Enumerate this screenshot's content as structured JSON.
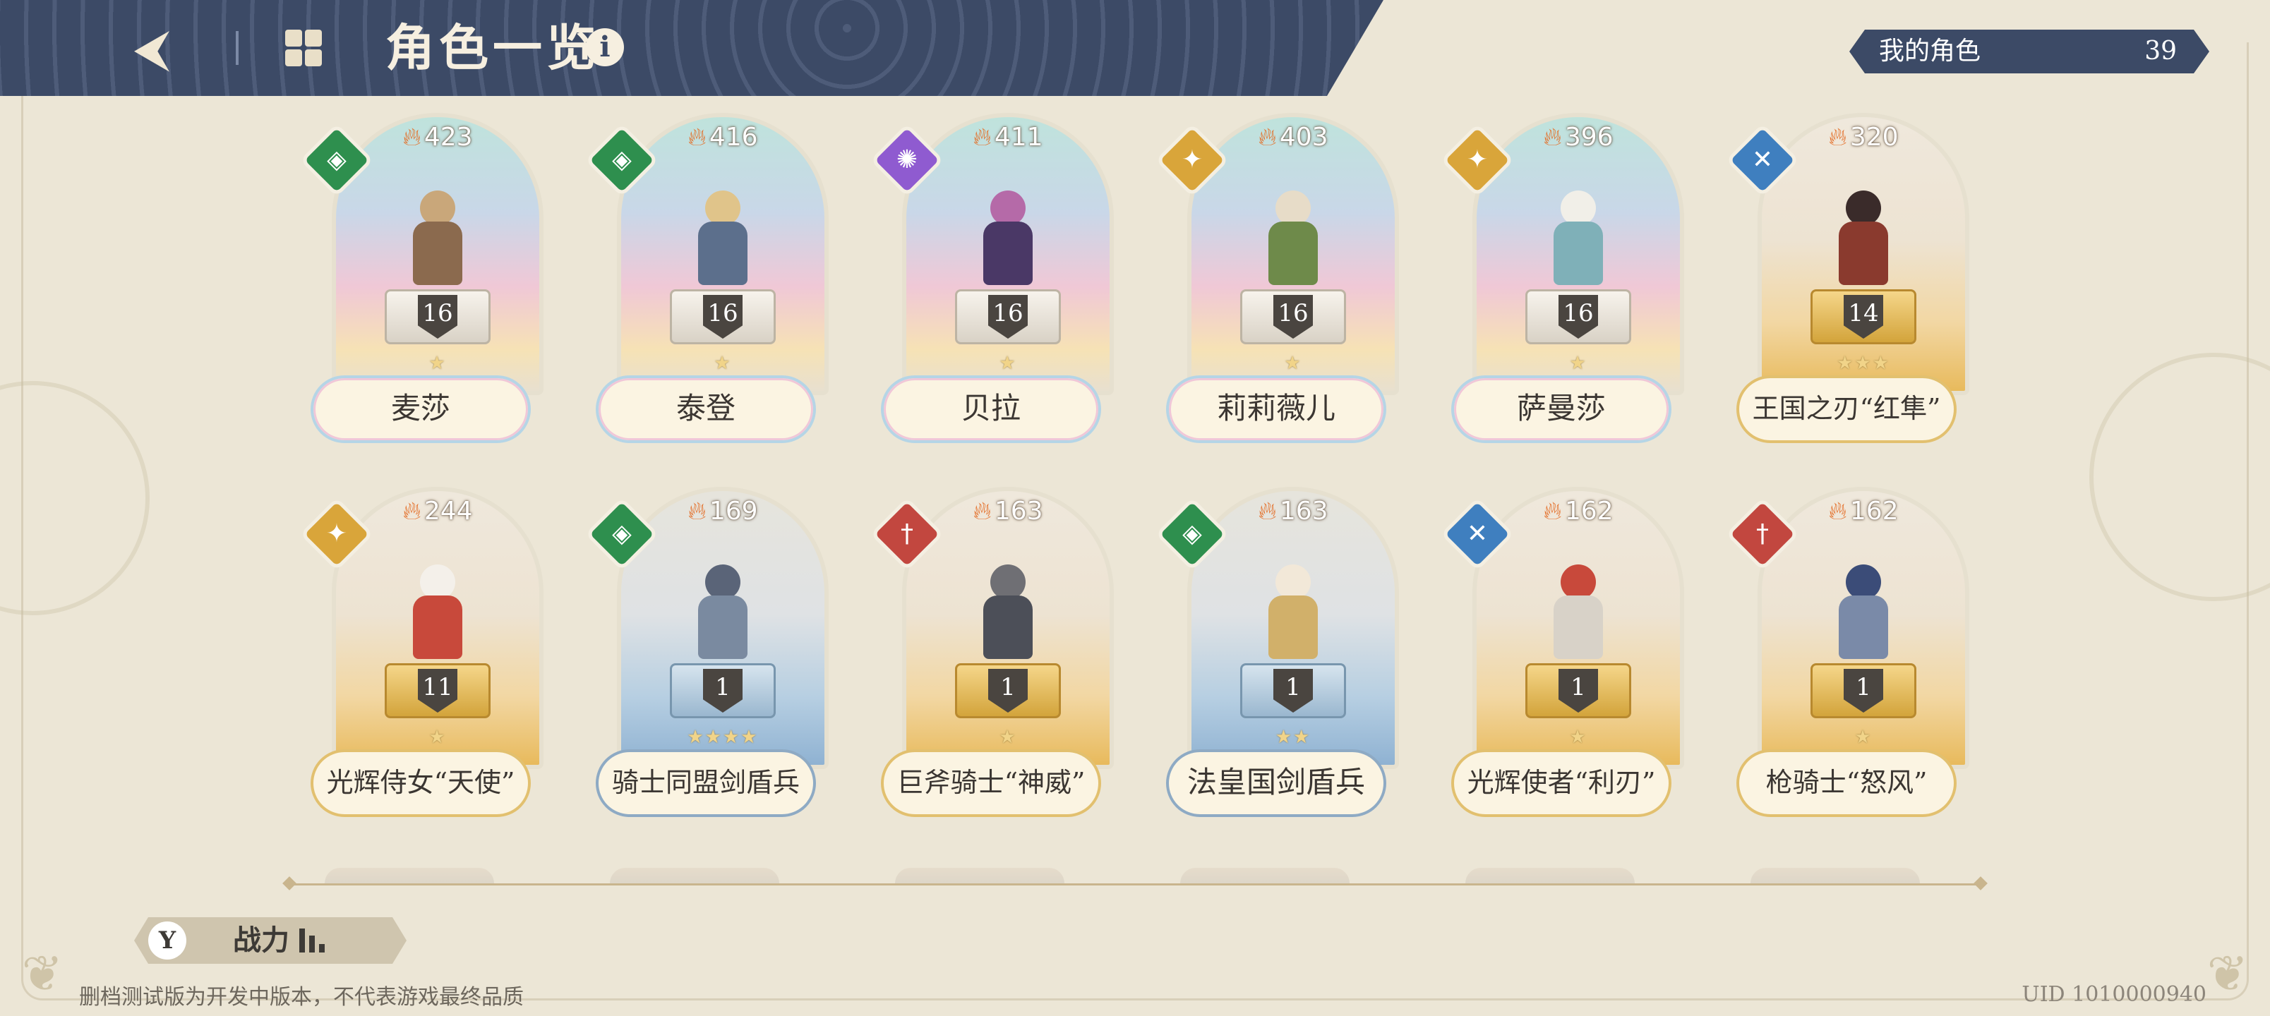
{
  "header": {
    "title": "角色一览",
    "back_icon": "back-arrow-icon",
    "grid_icon": "grid-view-icon",
    "info_icon": "info-icon",
    "info_glyph": "i",
    "bg_color": "#3c4a66"
  },
  "my_characters": {
    "label": "我的角色",
    "count": "39"
  },
  "characters": [
    {
      "name": "麦莎",
      "power": "423",
      "level": "16",
      "stars": "★",
      "element": "green-shield",
      "theme": "rainbow"
    },
    {
      "name": "泰登",
      "power": "416",
      "level": "16",
      "stars": "★",
      "element": "green-shield",
      "theme": "rainbow"
    },
    {
      "name": "贝拉",
      "power": "411",
      "level": "16",
      "stars": "★",
      "element": "purple-magic",
      "theme": "rainbow"
    },
    {
      "name": "莉莉薇儿",
      "power": "403",
      "level": "16",
      "stars": "★",
      "element": "gold-star",
      "theme": "rainbow"
    },
    {
      "name": "萨曼莎",
      "power": "396",
      "level": "16",
      "stars": "★",
      "element": "gold-star",
      "theme": "rainbow"
    },
    {
      "name": "王国之刃“红隼”",
      "power": "320",
      "level": "14",
      "stars": "★★★",
      "element": "blue-cross",
      "theme": "gold"
    },
    {
      "name": "光辉侍女“天使”",
      "power": "244",
      "level": "11",
      "stars": "★",
      "element": "gold-star",
      "theme": "gold"
    },
    {
      "name": "骑士同盟剑盾兵",
      "power": "169",
      "level": "1",
      "stars": "★★★★",
      "element": "green-shield",
      "theme": "blue"
    },
    {
      "name": "巨斧骑士“神威”",
      "power": "163",
      "level": "1",
      "stars": "★",
      "element": "red-sword",
      "theme": "gold"
    },
    {
      "name": "法皇国剑盾兵",
      "power": "163",
      "level": "1",
      "stars": "★★",
      "element": "green-shield",
      "theme": "blue"
    },
    {
      "name": "光辉使者“利刃”",
      "power": "162",
      "level": "1",
      "stars": "★",
      "element": "blue-cross",
      "theme": "gold"
    },
    {
      "name": "枪骑士“怒风”",
      "power": "162",
      "level": "1",
      "stars": "★",
      "element": "red-sword",
      "theme": "gold"
    }
  ],
  "footer": {
    "power_label": "战力",
    "power_icon": "filter-icon",
    "power_glyph": "Y",
    "disclaimer": "删档测试版为开发中版本，不代表游戏最终品质",
    "uid": "UID 1010000940"
  }
}
